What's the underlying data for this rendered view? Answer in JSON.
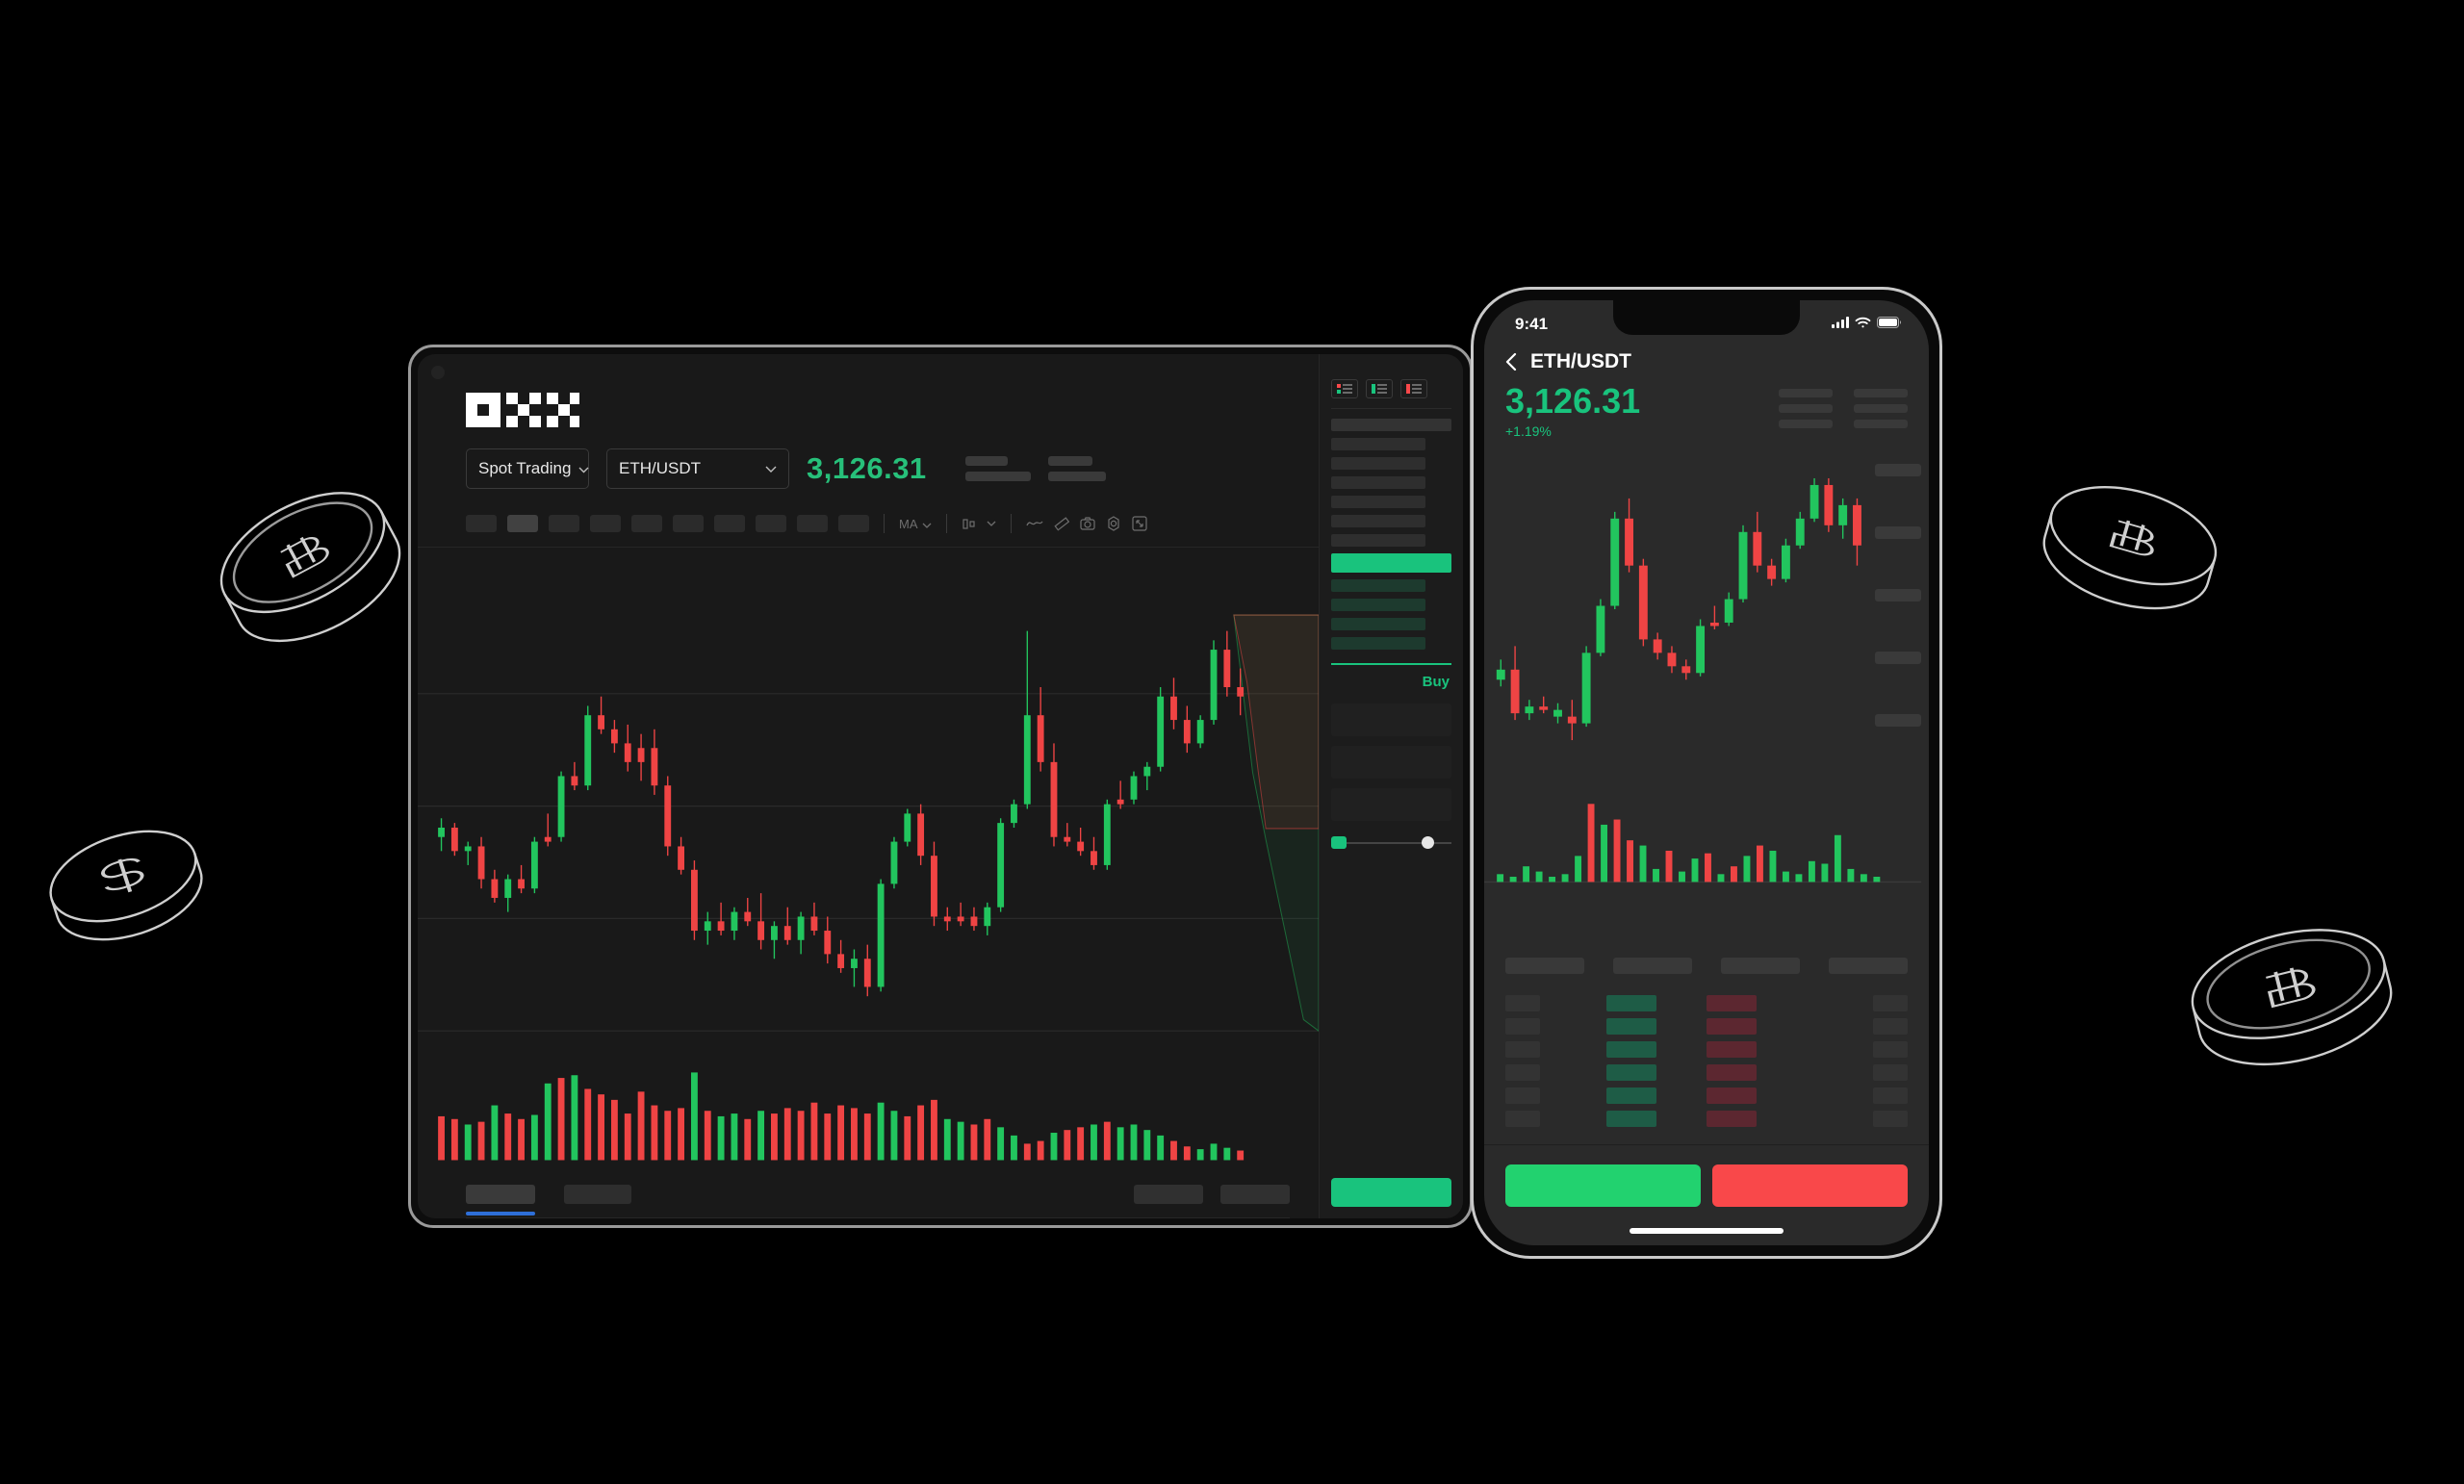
{
  "brand": {
    "name": "OKX",
    "accent_green": "#19c37d",
    "accent_red": "#f9484a",
    "accent_blue": "#2e6fd8"
  },
  "tablet": {
    "logo_text": "OKX",
    "controls": {
      "trading_mode": {
        "label": "Spot Trading",
        "icon": "chevron-down-icon"
      },
      "pair": {
        "label": "ETH/USDT",
        "icon": "chevron-down-icon"
      },
      "price": "3,126.31"
    },
    "toolbar": {
      "timeframes": [
        "",
        "",
        "",
        "",
        "",
        "",
        "",
        "",
        "",
        ""
      ],
      "active_timeframe_index": 1,
      "ma_label": "MA",
      "icons": [
        "chevron-down-icon",
        "candle-type-icon",
        "chevron-down-icon",
        "line-wave-icon",
        "ruler-icon",
        "camera-icon",
        "settings-icon",
        "fullscreen-icon"
      ]
    },
    "panel": {
      "orderbook_view_icons": [
        "orderbook-both-icon",
        "orderbook-bids-icon",
        "orderbook-asks-icon"
      ],
      "buy_tab_label": "Buy"
    }
  },
  "phone": {
    "status": {
      "time": "9:41",
      "icons": [
        "cellular-icon",
        "wifi-icon",
        "battery-icon"
      ]
    },
    "header": {
      "back_icon": "chevron-left-icon",
      "title": "ETH/USDT"
    },
    "price": {
      "value": "3,126.31",
      "change": "+1.19%"
    },
    "actions": {
      "buy_label": "",
      "sell_label": ""
    }
  },
  "coins": [
    {
      "symbol": "bitcoin-coin",
      "glyph": "B"
    },
    {
      "symbol": "dollar-coin",
      "glyph": "S"
    },
    {
      "symbol": "bitcoin-coin",
      "glyph": "B"
    },
    {
      "symbol": "bitcoin-coin",
      "glyph": "B"
    }
  ],
  "chart_data": {
    "type": "candlestick",
    "title": "ETH/USDT",
    "xlabel": "",
    "ylabel": "",
    "grid": true,
    "legend": "none",
    "tablet_candles": [
      {
        "o": 44,
        "h": 48,
        "l": 41,
        "c": 46,
        "d": "up"
      },
      {
        "o": 46,
        "h": 47,
        "l": 40,
        "c": 41,
        "d": "down"
      },
      {
        "o": 41,
        "h": 43,
        "l": 38,
        "c": 42,
        "d": "up"
      },
      {
        "o": 42,
        "h": 44,
        "l": 33,
        "c": 35,
        "d": "down"
      },
      {
        "o": 35,
        "h": 37,
        "l": 30,
        "c": 31,
        "d": "down"
      },
      {
        "o": 31,
        "h": 36,
        "l": 28,
        "c": 35,
        "d": "up"
      },
      {
        "o": 35,
        "h": 38,
        "l": 32,
        "c": 33,
        "d": "down"
      },
      {
        "o": 33,
        "h": 44,
        "l": 32,
        "c": 43,
        "d": "up"
      },
      {
        "o": 43,
        "h": 49,
        "l": 42,
        "c": 44,
        "d": "down"
      },
      {
        "o": 44,
        "h": 58,
        "l": 43,
        "c": 57,
        "d": "up"
      },
      {
        "o": 57,
        "h": 60,
        "l": 54,
        "c": 55,
        "d": "down"
      },
      {
        "o": 55,
        "h": 72,
        "l": 54,
        "c": 70,
        "d": "up"
      },
      {
        "o": 70,
        "h": 74,
        "l": 66,
        "c": 67,
        "d": "down"
      },
      {
        "o": 67,
        "h": 69,
        "l": 62,
        "c": 64,
        "d": "down"
      },
      {
        "o": 64,
        "h": 68,
        "l": 58,
        "c": 60,
        "d": "down"
      },
      {
        "o": 60,
        "h": 66,
        "l": 56,
        "c": 63,
        "d": "down"
      },
      {
        "o": 63,
        "h": 67,
        "l": 53,
        "c": 55,
        "d": "down"
      },
      {
        "o": 55,
        "h": 57,
        "l": 40,
        "c": 42,
        "d": "down"
      },
      {
        "o": 42,
        "h": 44,
        "l": 36,
        "c": 37,
        "d": "down"
      },
      {
        "o": 37,
        "h": 39,
        "l": 22,
        "c": 24,
        "d": "down"
      },
      {
        "o": 24,
        "h": 28,
        "l": 21,
        "c": 26,
        "d": "up"
      },
      {
        "o": 26,
        "h": 30,
        "l": 23,
        "c": 24,
        "d": "down"
      },
      {
        "o": 24,
        "h": 29,
        "l": 22,
        "c": 28,
        "d": "up"
      },
      {
        "o": 28,
        "h": 31,
        "l": 25,
        "c": 26,
        "d": "down"
      },
      {
        "o": 26,
        "h": 32,
        "l": 20,
        "c": 22,
        "d": "down"
      },
      {
        "o": 22,
        "h": 26,
        "l": 18,
        "c": 25,
        "d": "up"
      },
      {
        "o": 25,
        "h": 29,
        "l": 21,
        "c": 22,
        "d": "down"
      },
      {
        "o": 22,
        "h": 28,
        "l": 19,
        "c": 27,
        "d": "up"
      },
      {
        "o": 27,
        "h": 30,
        "l": 23,
        "c": 24,
        "d": "down"
      },
      {
        "o": 24,
        "h": 27,
        "l": 17,
        "c": 19,
        "d": "down"
      },
      {
        "o": 19,
        "h": 22,
        "l": 15,
        "c": 16,
        "d": "down"
      },
      {
        "o": 16,
        "h": 20,
        "l": 12,
        "c": 18,
        "d": "up"
      },
      {
        "o": 18,
        "h": 21,
        "l": 10,
        "c": 12,
        "d": "down"
      },
      {
        "o": 12,
        "h": 35,
        "l": 11,
        "c": 34,
        "d": "up"
      },
      {
        "o": 34,
        "h": 44,
        "l": 33,
        "c": 43,
        "d": "up"
      },
      {
        "o": 43,
        "h": 50,
        "l": 42,
        "c": 49,
        "d": "up"
      },
      {
        "o": 49,
        "h": 51,
        "l": 38,
        "c": 40,
        "d": "down"
      },
      {
        "o": 40,
        "h": 43,
        "l": 25,
        "c": 27,
        "d": "down"
      },
      {
        "o": 27,
        "h": 29,
        "l": 24,
        "c": 26,
        "d": "down"
      },
      {
        "o": 26,
        "h": 30,
        "l": 25,
        "c": 27,
        "d": "down"
      },
      {
        "o": 27,
        "h": 29,
        "l": 24,
        "c": 25,
        "d": "down"
      },
      {
        "o": 25,
        "h": 30,
        "l": 23,
        "c": 29,
        "d": "up"
      },
      {
        "o": 29,
        "h": 48,
        "l": 28,
        "c": 47,
        "d": "up"
      },
      {
        "o": 47,
        "h": 52,
        "l": 46,
        "c": 51,
        "d": "up"
      },
      {
        "o": 51,
        "h": 88,
        "l": 50,
        "c": 70,
        "d": "up"
      },
      {
        "o": 70,
        "h": 76,
        "l": 58,
        "c": 60,
        "d": "down"
      },
      {
        "o": 60,
        "h": 64,
        "l": 42,
        "c": 44,
        "d": "down"
      },
      {
        "o": 44,
        "h": 47,
        "l": 42,
        "c": 43,
        "d": "down"
      },
      {
        "o": 43,
        "h": 46,
        "l": 40,
        "c": 41,
        "d": "down"
      },
      {
        "o": 41,
        "h": 44,
        "l": 37,
        "c": 38,
        "d": "down"
      },
      {
        "o": 38,
        "h": 52,
        "l": 37,
        "c": 51,
        "d": "up"
      },
      {
        "o": 51,
        "h": 56,
        "l": 50,
        "c": 52,
        "d": "down"
      },
      {
        "o": 52,
        "h": 58,
        "l": 51,
        "c": 57,
        "d": "up"
      },
      {
        "o": 57,
        "h": 60,
        "l": 54,
        "c": 59,
        "d": "up"
      },
      {
        "o": 59,
        "h": 76,
        "l": 58,
        "c": 74,
        "d": "up"
      },
      {
        "o": 74,
        "h": 78,
        "l": 67,
        "c": 69,
        "d": "down"
      },
      {
        "o": 69,
        "h": 72,
        "l": 62,
        "c": 64,
        "d": "down"
      },
      {
        "o": 64,
        "h": 70,
        "l": 63,
        "c": 69,
        "d": "up"
      },
      {
        "o": 69,
        "h": 86,
        "l": 68,
        "c": 84,
        "d": "up"
      },
      {
        "o": 84,
        "h": 88,
        "l": 74,
        "c": 76,
        "d": "down"
      },
      {
        "o": 76,
        "h": 80,
        "l": 70,
        "c": 74,
        "d": "down"
      }
    ],
    "tablet_volumes": [
      {
        "v": 32,
        "d": "down"
      },
      {
        "v": 30,
        "d": "down"
      },
      {
        "v": 26,
        "d": "up"
      },
      {
        "v": 28,
        "d": "down"
      },
      {
        "v": 40,
        "d": "up"
      },
      {
        "v": 34,
        "d": "down"
      },
      {
        "v": 30,
        "d": "down"
      },
      {
        "v": 33,
        "d": "up"
      },
      {
        "v": 56,
        "d": "up"
      },
      {
        "v": 60,
        "d": "down"
      },
      {
        "v": 62,
        "d": "up"
      },
      {
        "v": 52,
        "d": "down"
      },
      {
        "v": 48,
        "d": "down"
      },
      {
        "v": 44,
        "d": "down"
      },
      {
        "v": 34,
        "d": "down"
      },
      {
        "v": 50,
        "d": "down"
      },
      {
        "v": 40,
        "d": "down"
      },
      {
        "v": 36,
        "d": "down"
      },
      {
        "v": 38,
        "d": "down"
      },
      {
        "v": 64,
        "d": "up"
      },
      {
        "v": 36,
        "d": "down"
      },
      {
        "v": 32,
        "d": "up"
      },
      {
        "v": 34,
        "d": "up"
      },
      {
        "v": 30,
        "d": "down"
      },
      {
        "v": 36,
        "d": "up"
      },
      {
        "v": 34,
        "d": "down"
      },
      {
        "v": 38,
        "d": "down"
      },
      {
        "v": 36,
        "d": "down"
      },
      {
        "v": 42,
        "d": "down"
      },
      {
        "v": 34,
        "d": "down"
      },
      {
        "v": 40,
        "d": "down"
      },
      {
        "v": 38,
        "d": "down"
      },
      {
        "v": 34,
        "d": "down"
      },
      {
        "v": 42,
        "d": "up"
      },
      {
        "v": 36,
        "d": "up"
      },
      {
        "v": 32,
        "d": "down"
      },
      {
        "v": 40,
        "d": "down"
      },
      {
        "v": 44,
        "d": "down"
      },
      {
        "v": 30,
        "d": "up"
      },
      {
        "v": 28,
        "d": "up"
      },
      {
        "v": 26,
        "d": "down"
      },
      {
        "v": 30,
        "d": "down"
      },
      {
        "v": 24,
        "d": "up"
      },
      {
        "v": 18,
        "d": "up"
      },
      {
        "v": 12,
        "d": "down"
      },
      {
        "v": 14,
        "d": "down"
      },
      {
        "v": 20,
        "d": "up"
      },
      {
        "v": 22,
        "d": "down"
      },
      {
        "v": 24,
        "d": "down"
      },
      {
        "v": 26,
        "d": "up"
      },
      {
        "v": 28,
        "d": "down"
      },
      {
        "v": 24,
        "d": "up"
      },
      {
        "v": 26,
        "d": "up"
      },
      {
        "v": 22,
        "d": "up"
      },
      {
        "v": 18,
        "d": "up"
      },
      {
        "v": 14,
        "d": "down"
      },
      {
        "v": 10,
        "d": "down"
      },
      {
        "v": 8,
        "d": "up"
      },
      {
        "v": 12,
        "d": "up"
      },
      {
        "v": 9,
        "d": "up"
      },
      {
        "v": 7,
        "d": "down"
      }
    ],
    "phone_candles": [
      {
        "o": 30,
        "h": 36,
        "l": 28,
        "c": 33,
        "d": "up"
      },
      {
        "o": 33,
        "h": 40,
        "l": 18,
        "c": 20,
        "d": "down"
      },
      {
        "o": 20,
        "h": 24,
        "l": 18,
        "c": 22,
        "d": "up"
      },
      {
        "o": 22,
        "h": 25,
        "l": 20,
        "c": 21,
        "d": "down"
      },
      {
        "o": 21,
        "h": 23,
        "l": 17,
        "c": 19,
        "d": "up"
      },
      {
        "o": 19,
        "h": 24,
        "l": 12,
        "c": 17,
        "d": "down"
      },
      {
        "o": 17,
        "h": 40,
        "l": 16,
        "c": 38,
        "d": "up"
      },
      {
        "o": 38,
        "h": 54,
        "l": 37,
        "c": 52,
        "d": "up"
      },
      {
        "o": 52,
        "h": 80,
        "l": 51,
        "c": 78,
        "d": "up"
      },
      {
        "o": 78,
        "h": 84,
        "l": 62,
        "c": 64,
        "d": "down"
      },
      {
        "o": 64,
        "h": 66,
        "l": 40,
        "c": 42,
        "d": "down"
      },
      {
        "o": 42,
        "h": 44,
        "l": 36,
        "c": 38,
        "d": "down"
      },
      {
        "o": 38,
        "h": 40,
        "l": 32,
        "c": 34,
        "d": "down"
      },
      {
        "o": 34,
        "h": 36,
        "l": 30,
        "c": 32,
        "d": "down"
      },
      {
        "o": 32,
        "h": 48,
        "l": 31,
        "c": 46,
        "d": "up"
      },
      {
        "o": 46,
        "h": 52,
        "l": 45,
        "c": 47,
        "d": "down"
      },
      {
        "o": 47,
        "h": 56,
        "l": 46,
        "c": 54,
        "d": "up"
      },
      {
        "o": 54,
        "h": 76,
        "l": 53,
        "c": 74,
        "d": "up"
      },
      {
        "o": 74,
        "h": 80,
        "l": 62,
        "c": 64,
        "d": "down"
      },
      {
        "o": 64,
        "h": 66,
        "l": 58,
        "c": 60,
        "d": "down"
      },
      {
        "o": 60,
        "h": 72,
        "l": 59,
        "c": 70,
        "d": "up"
      },
      {
        "o": 70,
        "h": 80,
        "l": 69,
        "c": 78,
        "d": "up"
      },
      {
        "o": 78,
        "h": 90,
        "l": 77,
        "c": 88,
        "d": "up"
      },
      {
        "o": 88,
        "h": 90,
        "l": 74,
        "c": 76,
        "d": "down"
      },
      {
        "o": 76,
        "h": 84,
        "l": 72,
        "c": 82,
        "d": "up"
      },
      {
        "o": 82,
        "h": 84,
        "l": 64,
        "c": 70,
        "d": "down"
      }
    ],
    "phone_volumes": [
      {
        "v": 3,
        "d": "up"
      },
      {
        "v": 2,
        "d": "up"
      },
      {
        "v": 6,
        "d": "up"
      },
      {
        "v": 4,
        "d": "up"
      },
      {
        "v": 2,
        "d": "up"
      },
      {
        "v": 3,
        "d": "up"
      },
      {
        "v": 10,
        "d": "up"
      },
      {
        "v": 30,
        "d": "down"
      },
      {
        "v": 22,
        "d": "up"
      },
      {
        "v": 24,
        "d": "down"
      },
      {
        "v": 16,
        "d": "down"
      },
      {
        "v": 14,
        "d": "up"
      },
      {
        "v": 5,
        "d": "up"
      },
      {
        "v": 12,
        "d": "down"
      },
      {
        "v": 4,
        "d": "up"
      },
      {
        "v": 9,
        "d": "up"
      },
      {
        "v": 11,
        "d": "down"
      },
      {
        "v": 3,
        "d": "up"
      },
      {
        "v": 6,
        "d": "down"
      },
      {
        "v": 10,
        "d": "up"
      },
      {
        "v": 14,
        "d": "down"
      },
      {
        "v": 12,
        "d": "up"
      },
      {
        "v": 4,
        "d": "up"
      },
      {
        "v": 3,
        "d": "up"
      },
      {
        "v": 8,
        "d": "up"
      },
      {
        "v": 7,
        "d": "up"
      },
      {
        "v": 18,
        "d": "up"
      },
      {
        "v": 5,
        "d": "up"
      },
      {
        "v": 3,
        "d": "up"
      },
      {
        "v": 2,
        "d": "up"
      }
    ]
  }
}
